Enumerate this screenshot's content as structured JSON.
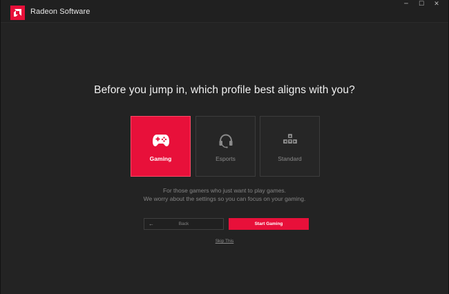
{
  "titlebar": {
    "app_title": "Radeon Software",
    "minimize_glyph": "─",
    "maximize_glyph": "☐",
    "close_glyph": "✕"
  },
  "question": "Before you jump in, which profile best aligns with you?",
  "profiles": [
    {
      "label": "Gaming",
      "icon": "gamepad-icon",
      "selected": true
    },
    {
      "label": "Esports",
      "icon": "headset-icon",
      "selected": false
    },
    {
      "label": "Standard",
      "icon": "keyboard-keys-icon",
      "selected": false
    }
  ],
  "description": {
    "line1": "For those gamers who just want to play games.",
    "line2": "We worry about the settings so you can focus on your gaming."
  },
  "buttons": {
    "back_label": "Back",
    "back_arrow": "←",
    "start_label": "Start Gaming",
    "skip_label": "Skip This"
  },
  "colors": {
    "accent": "#e8103a",
    "background": "#232323",
    "titlebar": "#202020"
  }
}
